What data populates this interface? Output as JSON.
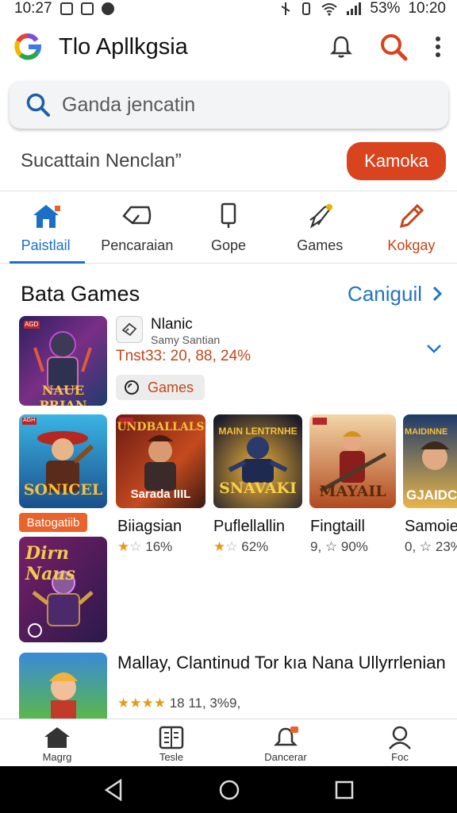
{
  "status_bar": {
    "time_left": "10:27",
    "battery": "53%",
    "time_right": "10:20"
  },
  "app_bar": {
    "title": "Tlo Apllkgsia"
  },
  "search": {
    "placeholder": "Ganda jencatin"
  },
  "promo": {
    "text": "Sucattain Nenclan”",
    "button": "Kamoka"
  },
  "tabs": [
    {
      "label": "Paistlail",
      "icon": "home-icon",
      "active": true
    },
    {
      "label": "Pencaraian",
      "icon": "tag-icon"
    },
    {
      "label": "Gope",
      "icon": "phone-icon"
    },
    {
      "label": "Games",
      "icon": "rocket-icon"
    },
    {
      "label": "Kokgay",
      "icon": "pencil-icon"
    }
  ],
  "section": {
    "title": "Bata Games",
    "see_all": "Caniguil"
  },
  "featured": {
    "name": "Nlanic",
    "developer": "Samy Santian",
    "stats": "Tnst33: 20, 88, 24%",
    "chip": "Games",
    "thumb_label": "NAUE PRJAN",
    "corner_tag": "AGD"
  },
  "grid": [
    {
      "name": "Biiagsian",
      "rating_text": "16%",
      "thumb_label": "SONICEL",
      "thumb_top": "AGH",
      "stars": 1
    },
    {
      "name": "Puflellallin",
      "rating_text": "62%",
      "thumb_label": "Sarada IIIL",
      "thumb_top": "UNDBALLALS",
      "stars": 1
    },
    {
      "name": "Fingtaill",
      "rating_text": "9, ☆ 90%",
      "thumb_label": "SNAVAKI",
      "thumb_top": "MAIN LENTRNHE",
      "stars": 0
    },
    {
      "name": "Samoie",
      "rating_text": "0, ☆ 23%",
      "thumb_label": "GJAIDCH",
      "thumb_top": "MAIDINNE",
      "stars": 0
    }
  ],
  "badge": {
    "text": "Batogatiib"
  },
  "side_thumb": {
    "label": "Dirn Naus"
  },
  "list_item": {
    "title": "Mallay, Clantinud Tor kıa Nana Ullyrrlenian",
    "rating": "18 11, 3%9,"
  },
  "bottom_nav": [
    {
      "label": "Magrg",
      "icon": "home-icon"
    },
    {
      "label": "Tesle",
      "icon": "book-icon"
    },
    {
      "label": "Dancerar",
      "icon": "bell-icon"
    },
    {
      "label": "Foc",
      "icon": "person-icon"
    }
  ],
  "colors": {
    "accent_blue": "#1b70c6",
    "accent_orange": "#d9431e",
    "star": "#e79a16"
  }
}
